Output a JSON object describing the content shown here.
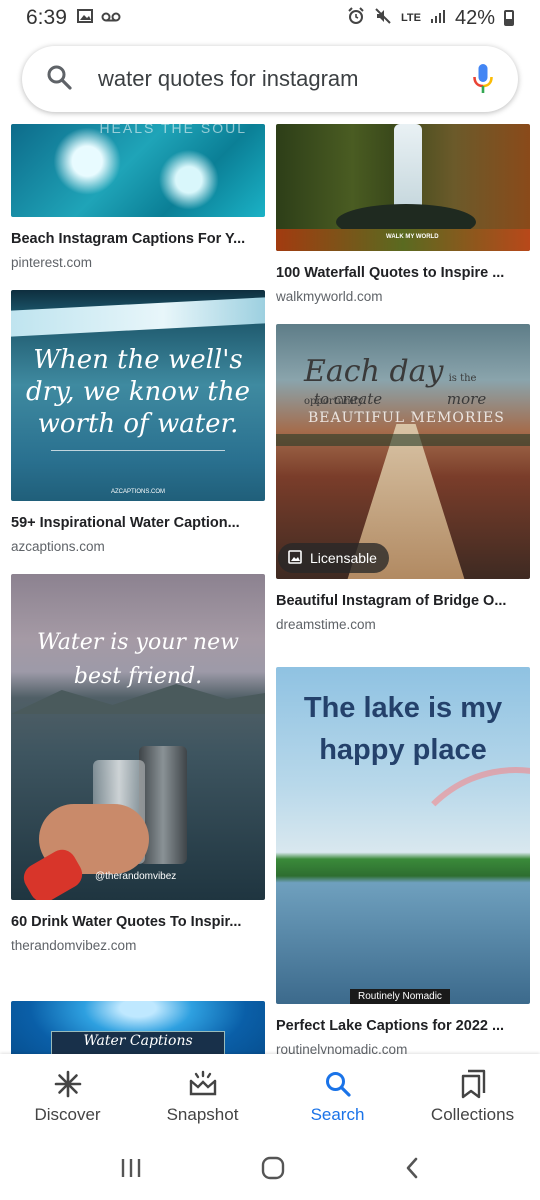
{
  "status": {
    "time": "6:39",
    "battery": "42%",
    "network": "LTE"
  },
  "search": {
    "query": "water quotes for instagram"
  },
  "results": [
    {
      "title": "Beach Instagram Captions For Y...",
      "source": "pinterest.com",
      "image_text": "HEALS THE SOUL"
    },
    {
      "title": "100 Waterfall Quotes to Inspire ...",
      "source": "walkmyworld.com",
      "image_text": "WALK MY WORLD"
    },
    {
      "title": "59+ Inspirational Water Caption...",
      "source": "azcaptions.com",
      "quote_lines": [
        "When the well's",
        "dry, we know the",
        "worth of water."
      ],
      "image_text": "AZCAPTIONS.COM"
    },
    {
      "title": "Beautiful Instagram of Bridge O...",
      "source": "dreamstime.com",
      "badge": "Licensable",
      "quote_main": "Each day",
      "quote_small": "is the opportunity",
      "quote_line2": "to create",
      "quote_more": "more",
      "quote_line3": "BEAUTIFUL MEMORIES"
    },
    {
      "title": "60 Drink Water Quotes To Inspir...",
      "source": "therandomvibez.com",
      "quote_lines": [
        "Water is your new",
        "best friend."
      ],
      "image_text": "@therandomvibez"
    },
    {
      "title": "Perfect Lake Captions for 2022 ...",
      "source": "routinelynomadic.com",
      "quote_lines": [
        "The lake is my",
        "happy place"
      ],
      "image_text": "Routinely Nomadic"
    },
    {
      "image_text": "Water Captions"
    }
  ],
  "bottom_nav": [
    {
      "label": "Discover",
      "icon": "asterisk-icon"
    },
    {
      "label": "Snapshot",
      "icon": "snapshot-icon"
    },
    {
      "label": "Search",
      "icon": "search-icon"
    },
    {
      "label": "Collections",
      "icon": "collections-icon"
    }
  ],
  "colors": {
    "accent": "#1a73e8",
    "text": "#202124",
    "secondary": "#5f6368"
  }
}
